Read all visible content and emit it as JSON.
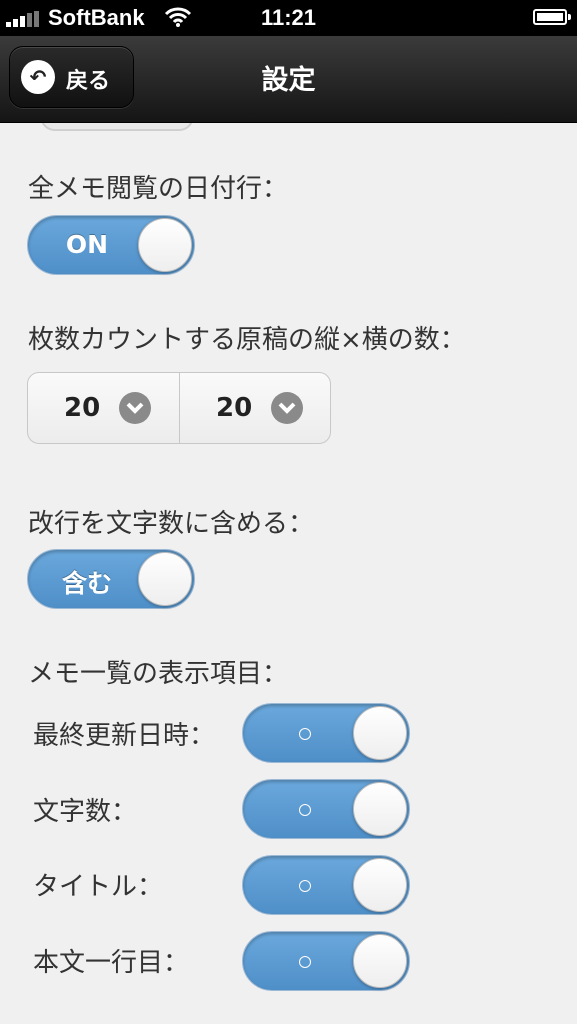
{
  "status": {
    "carrier": "SoftBank",
    "time": "11:21"
  },
  "header": {
    "back_label": "戻る",
    "title": "設定"
  },
  "settings": {
    "date_line_label": "全メモ閲覧の日付行：",
    "date_line_toggle": "ON",
    "grid_label": "枚数カウントする原稿の縦×横の数：",
    "grid_rows": "20",
    "grid_cols": "20",
    "newline_label": "改行を文字数に含める：",
    "newline_toggle": "含む",
    "list_items_label": "メモ一覧の表示項目：",
    "list_items": [
      {
        "label": "最終更新日時："
      },
      {
        "label": "文字数："
      },
      {
        "label": "タイトル："
      },
      {
        "label": "本文一行目："
      }
    ]
  },
  "colors": {
    "toggle_on": "#5a9ad2",
    "header": "#1e1e1e",
    "background": "#f0f0f0"
  },
  "icons": [
    "back-arrow-icon",
    "chevron-down-icon",
    "wifi-icon",
    "battery-icon",
    "signal-icon"
  ]
}
